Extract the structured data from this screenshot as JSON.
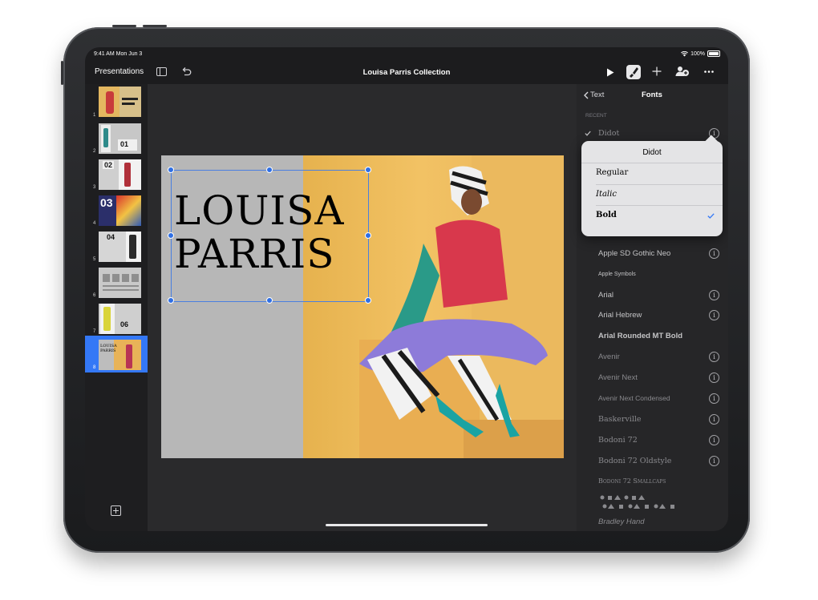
{
  "status": {
    "time": "9:41 AM  Mon Jun 3",
    "battery": "100%"
  },
  "toolbar": {
    "presentations": "Presentations",
    "title": "Louisa Parris Collection"
  },
  "slides": [
    {
      "num": "1"
    },
    {
      "num": "2",
      "label": "01"
    },
    {
      "num": "3",
      "label": "02"
    },
    {
      "num": "4",
      "label": "03"
    },
    {
      "num": "5",
      "label": "04"
    },
    {
      "num": "6"
    },
    {
      "num": "7",
      "label": "06"
    },
    {
      "num": "8",
      "label": "LOUISA PARRIS"
    }
  ],
  "slide": {
    "line1": "LOUISA",
    "line2": "PARRIS"
  },
  "panel": {
    "back_label": "Text",
    "title": "Fonts",
    "section": "RECENT",
    "current_font": "Didot",
    "fonts": [
      "Apple SD Gothic Neo",
      "Apple Symbols",
      "Arial",
      "Arial Hebrew",
      "Arial Rounded MT Bold",
      "Avenir",
      "Avenir Next",
      "Avenir Next Condensed",
      "Baskerville",
      "Bodoni 72",
      "Bodoni 72 Oldstyle",
      "Bodoni 72 Smallcaps",
      "Bradley Hand"
    ]
  },
  "popover": {
    "title": "Didot",
    "styles": [
      "Regular",
      "Italic",
      "Bold"
    ],
    "selected": "Bold"
  },
  "colors": {
    "accent": "#3478f6",
    "panel": "#262628",
    "slide_bg": "#e6b24e"
  }
}
